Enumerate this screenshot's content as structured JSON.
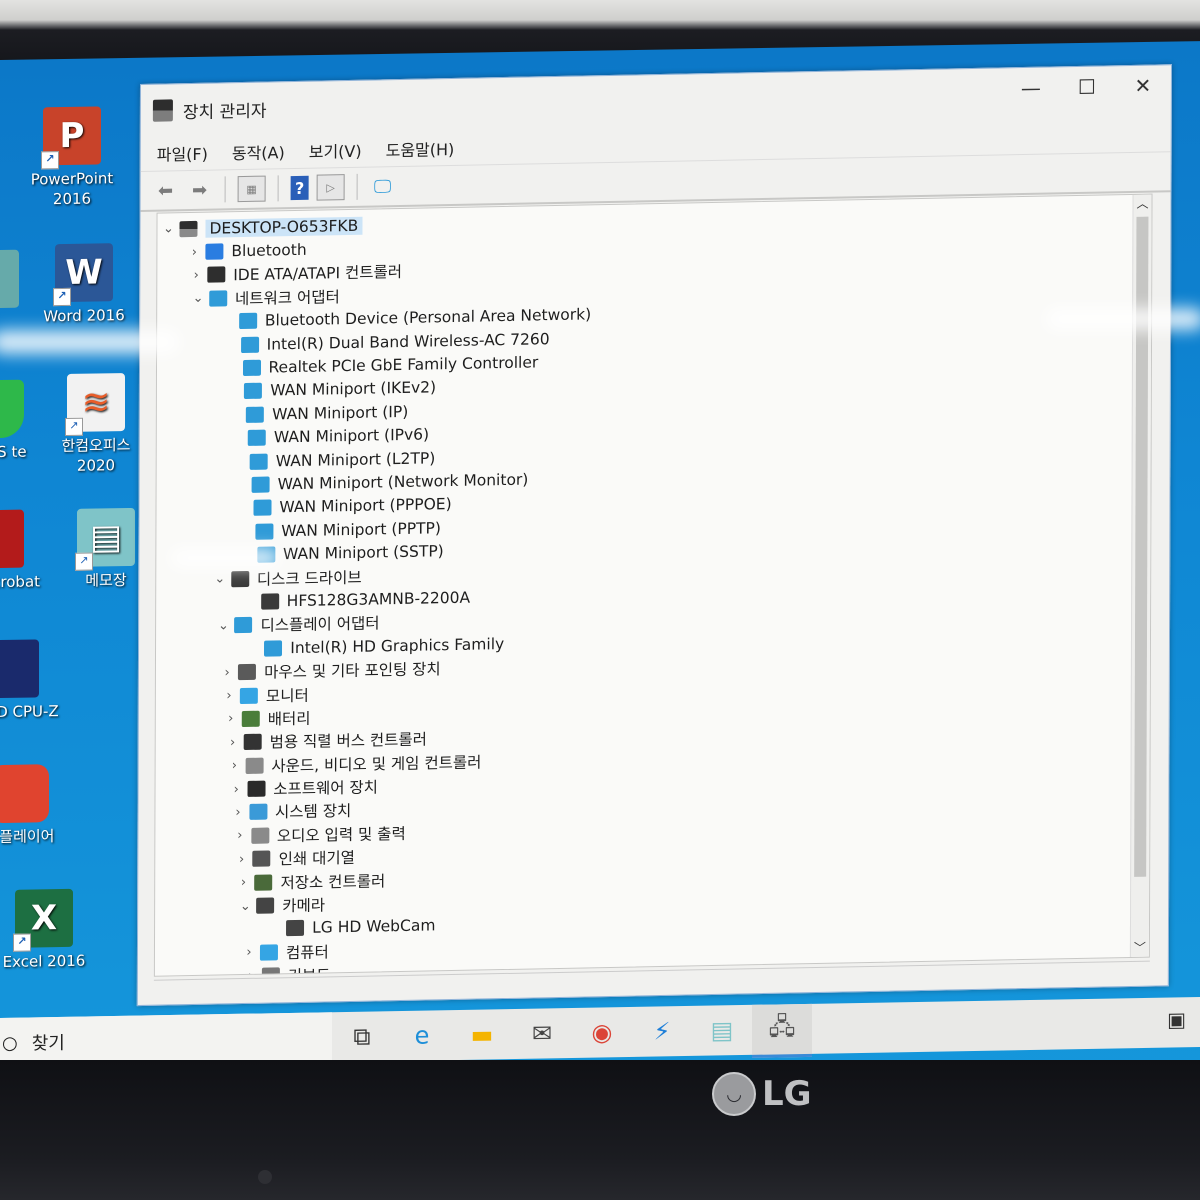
{
  "window": {
    "title": "장치 관리자",
    "controls": {
      "minimize": "—",
      "maximize": "☐",
      "close": "✕"
    },
    "menu": [
      "파일(F)",
      "동작(A)",
      "보기(V)",
      "도움말(H)"
    ],
    "toolbar_icons": [
      "back-arrow-icon",
      "forward-arrow-icon",
      "properties-icon",
      "help-icon",
      "run-icon",
      "monitor-scan-icon"
    ]
  },
  "tree": {
    "root": "DESKTOP-O653FKB",
    "nodes": [
      {
        "label": "Bluetooth",
        "level": 1,
        "state": "collapsed",
        "icon": "bluetooth-icon",
        "color": "#2a7de1"
      },
      {
        "label": "IDE ATA/ATAPI 컨트롤러",
        "level": 1,
        "state": "collapsed",
        "icon": "ide-controller-icon",
        "color": "#2e2e2e"
      },
      {
        "label": "네트워크 어댑터",
        "level": 1,
        "state": "expanded",
        "icon": "network-adapter-icon",
        "color": "#2f9bd8"
      },
      {
        "label": "Bluetooth Device (Personal Area Network)",
        "level": 2,
        "icon": "network-adapter-icon",
        "color": "#2f9bd8"
      },
      {
        "label": "Intel(R) Dual Band Wireless-AC 7260",
        "level": 2,
        "icon": "network-adapter-icon",
        "color": "#2f9bd8"
      },
      {
        "label": "Realtek PCIe GbE Family Controller",
        "level": 2,
        "icon": "network-adapter-icon",
        "color": "#2f9bd8"
      },
      {
        "label": "WAN Miniport (IKEv2)",
        "level": 2,
        "icon": "network-adapter-icon",
        "color": "#2f9bd8"
      },
      {
        "label": "WAN Miniport (IP)",
        "level": 2,
        "icon": "network-adapter-icon",
        "color": "#2f9bd8"
      },
      {
        "label": "WAN Miniport (IPv6)",
        "level": 2,
        "icon": "network-adapter-icon",
        "color": "#2f9bd8"
      },
      {
        "label": "WAN Miniport (L2TP)",
        "level": 2,
        "icon": "network-adapter-icon",
        "color": "#2f9bd8"
      },
      {
        "label": "WAN Miniport (Network Monitor)",
        "level": 2,
        "icon": "network-adapter-icon",
        "color": "#2f9bd8"
      },
      {
        "label": "WAN Miniport (PPPOE)",
        "level": 2,
        "icon": "network-adapter-icon",
        "color": "#2f9bd8"
      },
      {
        "label": "WAN Miniport (PPTP)",
        "level": 2,
        "icon": "network-adapter-icon",
        "color": "#2f9bd8"
      },
      {
        "label": "WAN Miniport (SSTP)",
        "level": 2,
        "icon": "network-adapter-icon",
        "color": "#2f9bd8"
      },
      {
        "label": "디스크 드라이브",
        "level": 1,
        "state": "expanded",
        "icon": "disk-drive-icon",
        "color": "#3a3a3a"
      },
      {
        "label": "HFS128G3AMNB-2200A",
        "level": 2,
        "icon": "disk-drive-icon",
        "color": "#3a3a3a"
      },
      {
        "label": "디스플레이 어댑터",
        "level": 1,
        "state": "expanded",
        "icon": "display-adapter-icon",
        "color": "#2f9bd8"
      },
      {
        "label": "Intel(R) HD Graphics Family",
        "level": 2,
        "icon": "display-adapter-icon",
        "color": "#2f9bd8"
      },
      {
        "label": "마우스 및 기타 포인팅 장치",
        "level": 1,
        "state": "collapsed",
        "icon": "mouse-icon",
        "color": "#5a5a5a"
      },
      {
        "label": "모니터",
        "level": 1,
        "state": "collapsed",
        "icon": "monitor-icon",
        "color": "#35a5e4"
      },
      {
        "label": "배터리",
        "level": 1,
        "state": "collapsed",
        "icon": "battery-icon",
        "color": "#4a7d3a"
      },
      {
        "label": "범용 직렬 버스 컨트롤러",
        "level": 1,
        "state": "collapsed",
        "icon": "usb-icon",
        "color": "#333333"
      },
      {
        "label": "사운드, 비디오 및 게임 컨트롤러",
        "level": 1,
        "state": "collapsed",
        "icon": "speaker-icon",
        "color": "#8a8a8a"
      },
      {
        "label": "소프트웨어 장치",
        "level": 1,
        "state": "collapsed",
        "icon": "software-device-icon",
        "color": "#2a2a2a"
      },
      {
        "label": "시스템 장치",
        "level": 1,
        "state": "collapsed",
        "icon": "system-folder-icon",
        "color": "#3a9ad8"
      },
      {
        "label": "오디오 입력 및 출력",
        "level": 1,
        "state": "collapsed",
        "icon": "speaker-icon",
        "color": "#8a8a8a"
      },
      {
        "label": "인쇄 대기열",
        "level": 1,
        "state": "collapsed",
        "icon": "printer-icon",
        "color": "#555555"
      },
      {
        "label": "저장소 컨트롤러",
        "level": 1,
        "state": "collapsed",
        "icon": "storage-controller-icon",
        "color": "#4a6a3a"
      },
      {
        "label": "카메라",
        "level": 1,
        "state": "expanded",
        "icon": "webcam-icon",
        "color": "#444444"
      },
      {
        "label": "LG HD WebCam",
        "level": 2,
        "icon": "webcam-icon",
        "color": "#444444"
      },
      {
        "label": "컴퓨터",
        "level": 1,
        "state": "collapsed",
        "icon": "computer-icon",
        "color": "#35a5e4"
      },
      {
        "label": "키보드",
        "level": 1,
        "state": "collapsed",
        "icon": "keyboard-icon",
        "color": "#777777"
      }
    ]
  },
  "desktop_icons": [
    {
      "label": "PowerPoint 2016",
      "icon": "powerpoint-icon",
      "color": "#c8432a",
      "glyph": "P"
    },
    {
      "label": "Word 2016",
      "icon": "word-icon",
      "color": "#2b5797",
      "glyph": "W"
    },
    {
      "label": "한컴오피스 2020",
      "icon": "hancom-office-icon",
      "color": "#f2f2f2",
      "glyph": "≋"
    },
    {
      "label": "메모장",
      "icon": "notepad-icon",
      "color": "#7fc4c8",
      "glyph": "▤"
    },
    {
      "label": "Excel 2016",
      "icon": "excel-icon",
      "color": "#1d6f42",
      "glyph": "X"
    }
  ],
  "desktop_icons_partial": [
    {
      "label": "통",
      "icon": "partial-icon"
    },
    {
      "label": "ab VS te",
      "icon": "green-app-icon",
      "color": "#2eb84a"
    },
    {
      "label": "dobe crobat",
      "icon": "acrobat-icon",
      "color": "#b31b1b"
    },
    {
      "label": "CPUID CPU-Z",
      "icon": "cpuz-icon",
      "color": "#1a2a6c"
    },
    {
      "label": "곰플레이어",
      "icon": "gom-player-icon",
      "color": "#e0442f"
    }
  ],
  "taskbar": {
    "search_label": "찾기",
    "apps": [
      {
        "name": "task-view-icon",
        "glyph": "⧉"
      },
      {
        "name": "edge-icon",
        "glyph": "e"
      },
      {
        "name": "file-explorer-icon",
        "glyph": "▬"
      },
      {
        "name": "mail-icon",
        "glyph": "✉"
      },
      {
        "name": "chrome-icon",
        "glyph": "◉"
      },
      {
        "name": "app-bolt-icon",
        "glyph": "⚡"
      },
      {
        "name": "notepad-taskbar-icon",
        "glyph": "▤"
      },
      {
        "name": "device-manager-taskbar-icon",
        "glyph": "🖧"
      }
    ],
    "news_icon": "▣"
  },
  "bezel": {
    "brand": "LG"
  }
}
